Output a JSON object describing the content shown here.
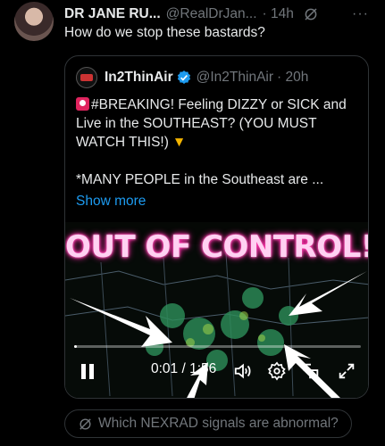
{
  "post": {
    "author_name": "DR JANE RU...",
    "author_handle": "@RealDrJan...",
    "time": "· 14h",
    "more": "···",
    "text": "How do we stop these bastards?"
  },
  "quote": {
    "author_name": "In2ThinAir",
    "author_handle": "@In2ThinAir",
    "time": "· 20h",
    "line1": "#BREAKING! Feeling DIZZY or SICK and Live in the SOUTHEAST? (YOU MUST WATCH THIS!)",
    "line2": "*MANY PEOPLE in the Southeast are ...",
    "show_more": "Show more",
    "verified_color": "#1d9bf0"
  },
  "video": {
    "headline": "OUT OF CONTROL!",
    "time_display": "0:01 / 1:56",
    "progress": 0.009
  },
  "grok_prompt": {
    "label": "Which NEXRAD signals are abnormal?"
  },
  "icons": {
    "grok": "grok-icon",
    "verified": "verified-badge-icon",
    "siren": "police-light-icon",
    "pointing": "backhand-index-pointing-down-icon",
    "pause": "pause-icon",
    "volume": "volume-icon",
    "settings": "gear-icon",
    "pip": "picture-in-picture-icon",
    "fullscreen": "fullscreen-icon"
  }
}
